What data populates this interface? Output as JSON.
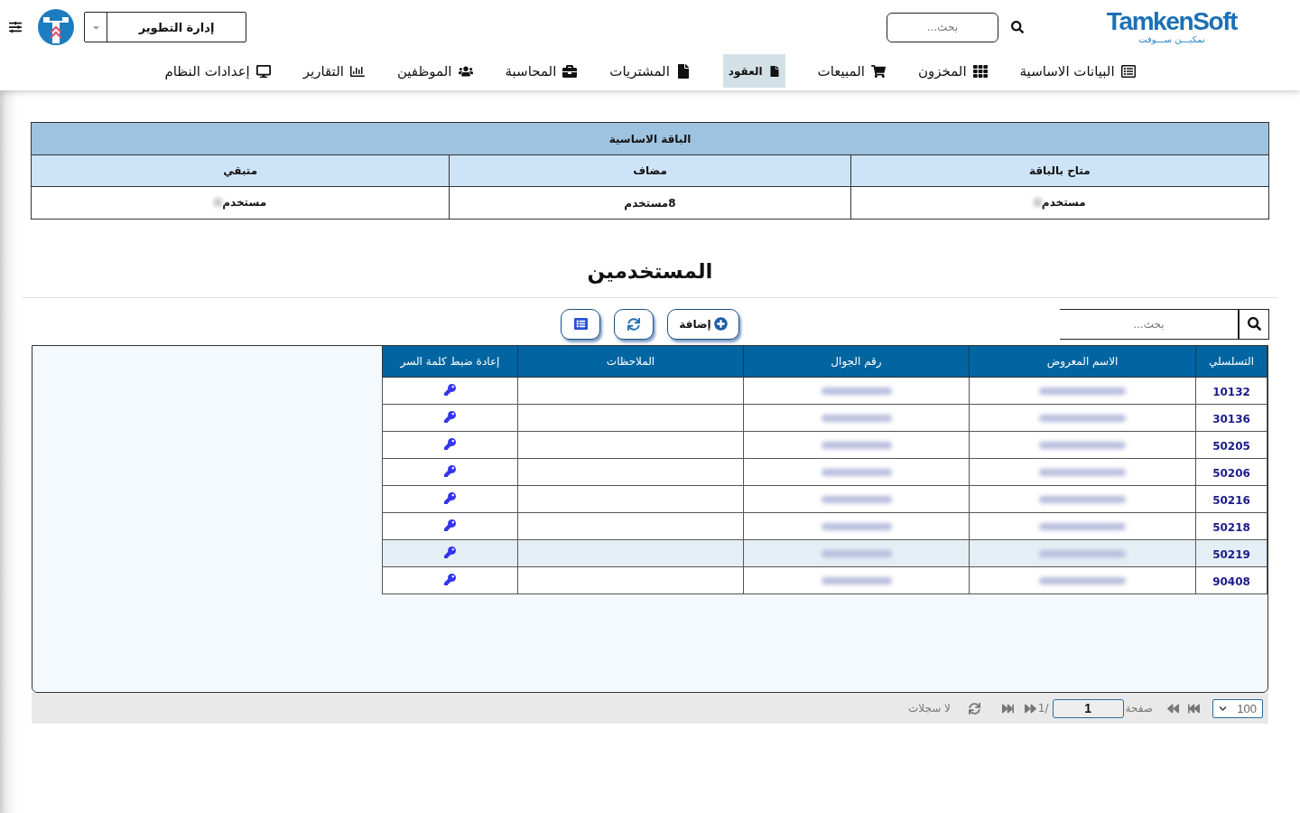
{
  "header": {
    "logo": {
      "text": "TamkenSoft",
      "subtitle": "تمكيـــن ســـوفت"
    },
    "search": {
      "placeholder": "بحث..."
    },
    "department_select": {
      "value": "إدارة التطوير"
    }
  },
  "nav": [
    {
      "label": "البيانات الاساسية",
      "selected": false
    },
    {
      "label": "المخزون",
      "selected": false
    },
    {
      "label": "المبيعات",
      "selected": false
    },
    {
      "label": "العقود",
      "selected": true
    },
    {
      "label": "المشتريات",
      "selected": false
    },
    {
      "label": "المحاسبة",
      "selected": false
    },
    {
      "label": "الموظفين",
      "selected": false
    },
    {
      "label": "التقارير",
      "selected": false
    },
    {
      "label": "إعدادات النظام",
      "selected": false
    }
  ],
  "package_table": {
    "title": "الباقة الاساسية",
    "columns": [
      "متاح بالباقة",
      "مضاف",
      "متبقي"
    ],
    "cells": [
      {
        "text": "مستخدم",
        "number_blurred": true
      },
      {
        "text": "8مستخدم",
        "number_blurred": false
      },
      {
        "text": "مستخدم",
        "number_blurred": true
      }
    ]
  },
  "users": {
    "title": "المستخدمين",
    "search": {
      "placeholder": "بحث..."
    },
    "buttons": [
      {
        "kind": "add",
        "label": "إضافة"
      },
      {
        "kind": "refresh"
      },
      {
        "kind": "columns"
      }
    ],
    "table": {
      "columns": [
        {
          "label": "التسلسلي",
          "kind": "serial"
        },
        {
          "label": "الاسم المعروض",
          "kind": "name"
        },
        {
          "label": "رقم الجوال",
          "kind": "mobile"
        },
        {
          "label": "الملاحظات",
          "kind": "notes"
        },
        {
          "label": "إعادة ضبط كلمة السر",
          "kind": "reset"
        }
      ],
      "rows": [
        {
          "serial": "10132",
          "name_blurred": true,
          "mobile_blurred": true,
          "selected": false
        },
        {
          "serial": "30136",
          "name_blurred": true,
          "mobile_blurred": true,
          "selected": false
        },
        {
          "serial": "50205",
          "name_blurred": true,
          "mobile_blurred": true,
          "selected": false
        },
        {
          "serial": "50206",
          "name_blurred": true,
          "mobile_blurred": true,
          "selected": false
        },
        {
          "serial": "50216",
          "name_blurred": true,
          "mobile_blurred": true,
          "selected": false
        },
        {
          "serial": "50218",
          "name_blurred": true,
          "mobile_blurred": true,
          "selected": false
        },
        {
          "serial": "50219",
          "name_blurred": true,
          "mobile_blurred": true,
          "selected": true
        },
        {
          "serial": "90408",
          "name_blurred": true,
          "mobile_blurred": true,
          "selected": false
        }
      ]
    },
    "pager": {
      "page_size": "100",
      "page_label": "صفحة",
      "page": "1",
      "total": "1/",
      "status": "لا سجلات"
    }
  }
}
